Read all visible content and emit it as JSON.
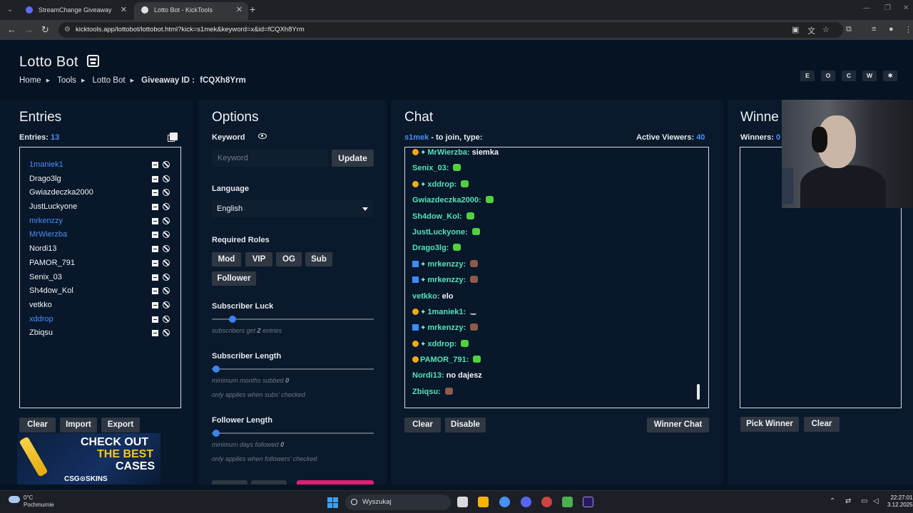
{
  "browser": {
    "tabs": [
      {
        "title": "StreamChange Giveaway"
      },
      {
        "title": "Lotto Bot - KickTools"
      }
    ],
    "url": "kicktools.app/lottobot/lottobot.html?kick=s1mek&keyword=x&id=fCQXh8Yrm"
  },
  "page": {
    "title": "Lotto Bot",
    "breadcrumb": {
      "home": "Home",
      "tools": "Tools",
      "current": "Lotto Bot",
      "giveaway_label": "Giveaway ID :",
      "giveaway_id": "fCQXh8Yrm"
    },
    "theme_buttons": [
      "E",
      "O",
      "C",
      "W",
      "✱"
    ]
  },
  "entries": {
    "heading": "Entries",
    "count_label": "Entries:",
    "count": "13",
    "items": [
      {
        "name": "1maniek1",
        "blue": true
      },
      {
        "name": "Drago3lg",
        "blue": false
      },
      {
        "name": "Gwiazdeczka2000",
        "blue": false
      },
      {
        "name": "JustLuckyone",
        "blue": false
      },
      {
        "name": "mrkenzzy",
        "blue": true
      },
      {
        "name": "MrWierzba",
        "blue": true
      },
      {
        "name": "Nordi13",
        "blue": false
      },
      {
        "name": "PAMOR_791",
        "blue": false
      },
      {
        "name": "Senix_03",
        "blue": false
      },
      {
        "name": "Sh4dow_Kol",
        "blue": false
      },
      {
        "name": "vetkko",
        "blue": false
      },
      {
        "name": "xddrop",
        "blue": true
      },
      {
        "name": "Zbiqsu",
        "blue": false
      }
    ],
    "buttons": {
      "clear": "Clear",
      "import": "Import",
      "export": "Export"
    }
  },
  "options": {
    "heading": "Options",
    "keyword_label": "Keyword",
    "keyword_placeholder": "Keyword",
    "update_label": "Update",
    "language_label": "Language",
    "language_value": "English",
    "roles_label": "Required Roles",
    "roles": [
      "Mod",
      "VIP",
      "OG",
      "Sub",
      "Follower"
    ],
    "sub_luck_label": "Subscriber Luck",
    "sub_luck_hint_pre": "subscribers get",
    "sub_luck_value": "2",
    "sub_luck_hint_post": "entries",
    "sub_length_label": "Subscriber Length",
    "sub_length_hint_pre": "minimum months subbed",
    "sub_length_value": "0",
    "sub_length_note": "only applies when subs' checked",
    "fol_length_label": "Follower Length",
    "fol_length_hint_pre": "minimum days followed",
    "fol_length_value": "0",
    "fol_length_note": "only applies when followers' checked"
  },
  "chat": {
    "heading": "Chat",
    "channel": "s1mek",
    "join_text": "- to join, type:",
    "viewers_label": "Active Viewers:",
    "viewers": "40",
    "messages": [
      {
        "badges": [
          "sub",
          "sp"
        ],
        "user": "MrWierzba:",
        "text": "siemka",
        "emote": ""
      },
      {
        "badges": [],
        "user": "Senix_03:",
        "text": "",
        "emote": "g"
      },
      {
        "badges": [
          "sub",
          "sp"
        ],
        "user": "xddrop:",
        "text": "",
        "emote": "g"
      },
      {
        "badges": [],
        "user": "Gwiazdeczka2000:",
        "text": "",
        "emote": "g"
      },
      {
        "badges": [],
        "user": "Sh4dow_Kol:",
        "text": "",
        "emote": "g"
      },
      {
        "badges": [],
        "user": "JustLuckyone:",
        "text": "",
        "emote": "g"
      },
      {
        "badges": [],
        "user": "Drago3lg:",
        "text": "",
        "emote": "g"
      },
      {
        "badges": [
          "sq",
          "sp"
        ],
        "user": "mrkenzzy:",
        "text": "",
        "emote": "b"
      },
      {
        "badges": [
          "sq",
          "sp"
        ],
        "user": "mrkenzzy:",
        "text": "",
        "emote": "b"
      },
      {
        "badges": [],
        "user": "vetkko:",
        "text": "elo",
        "emote": ""
      },
      {
        "badges": [
          "sub",
          "sp"
        ],
        "user": "1maniek1:",
        "text": "",
        "emote": "w"
      },
      {
        "badges": [
          "sq",
          "sp"
        ],
        "user": "mrkenzzy:",
        "text": "",
        "emote": "b"
      },
      {
        "badges": [
          "sub",
          "sp"
        ],
        "user": "xddrop:",
        "text": "",
        "emote": "g"
      },
      {
        "badges": [
          "sub"
        ],
        "user": "PAMOR_791:",
        "text": "",
        "emote": "g"
      },
      {
        "badges": [],
        "user": "Nordi13:",
        "text": "no dajesz",
        "emote": ""
      },
      {
        "badges": [],
        "user": "Zbiqsu:",
        "text": "",
        "emote": "b"
      }
    ],
    "buttons": {
      "clear": "Clear",
      "disable": "Disable",
      "winner_chat": "Winner Chat"
    }
  },
  "winners": {
    "heading": "Winne",
    "count_label": "Winners:",
    "count": "0",
    "buttons": {
      "pick": "Pick Winner",
      "clear": "Clear"
    }
  },
  "ad": {
    "line1": "CHECK OUT",
    "line2": "THE BEST",
    "line3": "CASES",
    "brand": "CSG⊙SKINS"
  },
  "taskbar": {
    "temp": "0°C",
    "weather": "Pochmurnie",
    "search_placeholder": "Wyszukaj",
    "time": "22:27:01",
    "date": "3.12.2025"
  }
}
